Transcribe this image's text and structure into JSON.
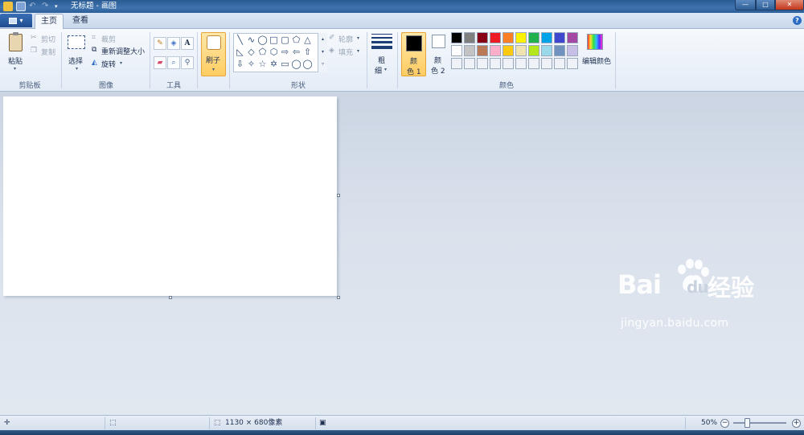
{
  "window": {
    "title": "无标题 - 画图",
    "buttons": {
      "minimize": "—",
      "maximize": "□",
      "close": "✕"
    }
  },
  "tabs": [
    {
      "label": "主页",
      "active": true
    },
    {
      "label": "查看",
      "active": false
    }
  ],
  "help_label": "?",
  "ribbon": {
    "clipboard": {
      "group_label": "剪贴板",
      "paste": "粘贴",
      "cut": "剪切",
      "copy": "复制"
    },
    "image": {
      "group_label": "图像",
      "select": "选择",
      "crop": "裁剪",
      "resize": "重新调整大小",
      "rotate": "旋转"
    },
    "tools": {
      "group_label": "工具",
      "text_glyph": "A"
    },
    "brushes": {
      "label": "刷子"
    },
    "shapes": {
      "group_label": "形状",
      "outline": "轮廓",
      "fill": "填充"
    },
    "size": {
      "label_line1": "粗",
      "label_line2": "细"
    },
    "colors": {
      "group_label": "颜色",
      "color1_line1": "颜",
      "color1_line2": "色 1",
      "color2_line1": "颜",
      "color2_line2": "色 2",
      "edit_colors": "编辑颜色",
      "color1_value": "#000000",
      "color2_value": "#ffffff",
      "palette_row1": [
        "#000000",
        "#7f7f7f",
        "#880015",
        "#ed1c24",
        "#ff7f27",
        "#fff200",
        "#22b14c",
        "#00a2e8",
        "#3f48cc",
        "#a349a4"
      ],
      "palette_row2": [
        "#ffffff",
        "#c3c3c3",
        "#b97a57",
        "#ffaec9",
        "#ffc90e",
        "#efe4b0",
        "#b5e61d",
        "#99d9ea",
        "#7092be",
        "#c8bfe7"
      ],
      "palette_row3": [
        "#eef2f7",
        "#eef2f7",
        "#eef2f7",
        "#eef2f7",
        "#eef2f7",
        "#eef2f7",
        "#eef2f7",
        "#eef2f7",
        "#eef2f7",
        "#eef2f7"
      ]
    }
  },
  "statusbar": {
    "image_size": "1130 × 680像素",
    "zoom": "50%",
    "zoom_out": "−",
    "zoom_in": "+"
  },
  "watermark": {
    "brand": "Bai",
    "brand_suffix": "du",
    "product": "经验",
    "url": "jingyan.baidu.com"
  }
}
